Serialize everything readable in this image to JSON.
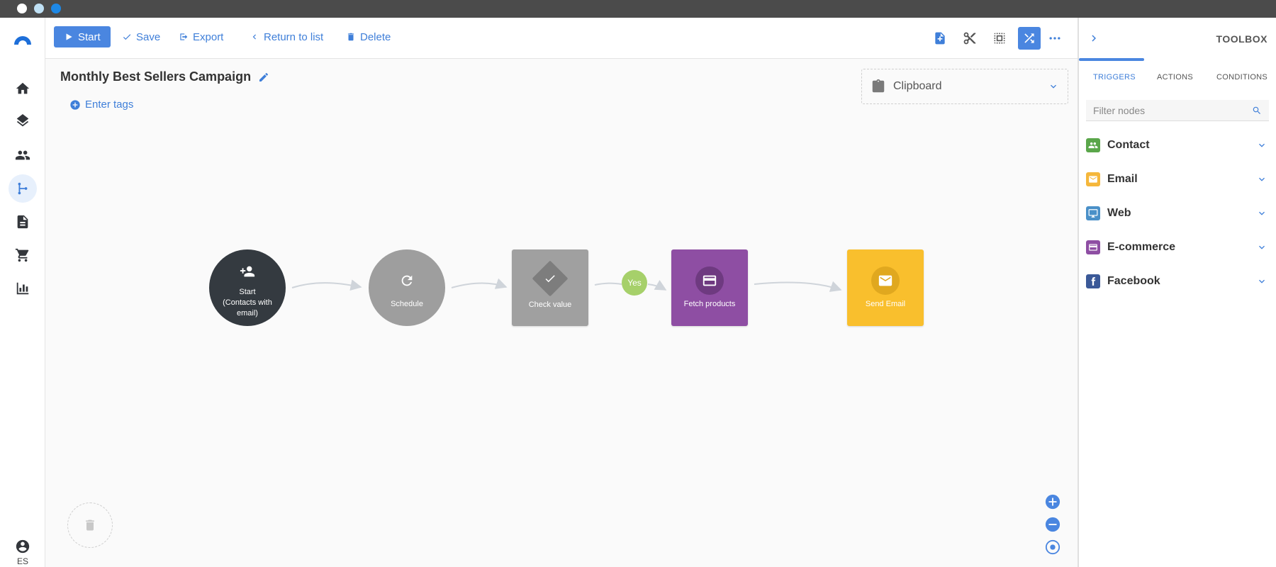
{
  "toolbar": {
    "start_label": "Start",
    "save_label": "Save",
    "export_label": "Export",
    "return_label": "Return to list",
    "delete_label": "Delete"
  },
  "campaign": {
    "title": "Monthly Best Sellers Campaign",
    "tags_label": "Enter tags"
  },
  "clipboard": {
    "label": "Clipboard"
  },
  "flow": {
    "nodes": [
      {
        "id": "start",
        "label_line1": "Start",
        "label_line2": "(Contacts with email)",
        "icon": "add-contacts-icon",
        "color": "#343a40"
      },
      {
        "id": "schedule",
        "label": "Schedule",
        "icon": "refresh-icon",
        "color": "#9e9e9e"
      },
      {
        "id": "check",
        "label": "Check value",
        "icon": "check-icon",
        "color": "#a0a0a0"
      },
      {
        "id": "fetch",
        "label": "Fetch products",
        "icon": "card-icon",
        "color": "#8e4ea3"
      },
      {
        "id": "email",
        "label": "Send Email",
        "icon": "mail-icon",
        "color": "#f9bf2d"
      }
    ],
    "yes_label": "Yes"
  },
  "user": {
    "lang": "ES"
  },
  "toolbox": {
    "title": "TOOLBOX",
    "tabs": [
      "TRIGGERS",
      "ACTIONS",
      "CONDITIONS"
    ],
    "active_tab": "TRIGGERS",
    "filter_placeholder": "Filter nodes",
    "categories": [
      {
        "label": "Contact",
        "color": "#5aa64a",
        "icon": "contacts-icon"
      },
      {
        "label": "Email",
        "color": "#f5b73b",
        "icon": "mail-icon"
      },
      {
        "label": "Web",
        "color": "#4a90c8",
        "icon": "monitor-icon"
      },
      {
        "label": "E-commerce",
        "color": "#8e4ea3",
        "icon": "card-icon"
      },
      {
        "label": "Facebook",
        "color": "#3b5998",
        "icon": "facebook-icon"
      }
    ]
  },
  "colors": {
    "accent": "#4a86e0",
    "yes_badge": "#a6d06a"
  }
}
